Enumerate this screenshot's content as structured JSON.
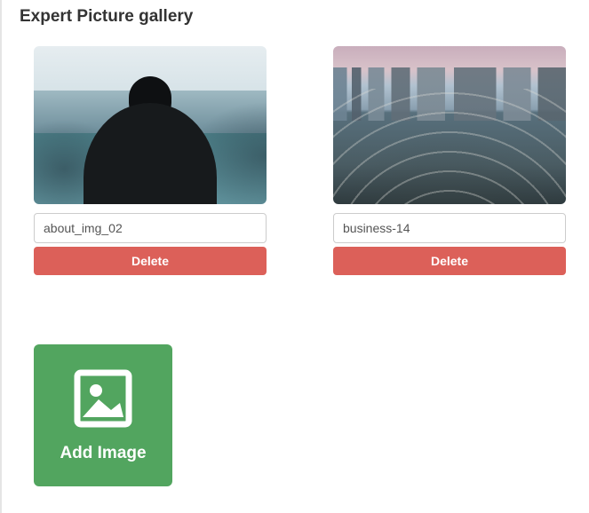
{
  "page_title": "Expert Picture gallery",
  "gallery": {
    "items": [
      {
        "name": "about_img_02",
        "delete_label": "Delete"
      },
      {
        "name": "business-14",
        "delete_label": "Delete"
      }
    ]
  },
  "add_button": {
    "label": "Add Image"
  },
  "colors": {
    "danger": "#dc6059",
    "success": "#52a55f"
  }
}
